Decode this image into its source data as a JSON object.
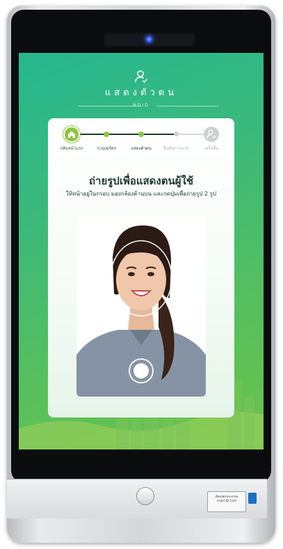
{
  "screen": {
    "title": "แสดงตัวตน",
    "subtitle": "NDID",
    "colors": {
      "accent": "#8cc63f",
      "text_dark": "#1e3a2c",
      "muted": "#b5c4bb"
    }
  },
  "stepper": {
    "steps": [
      {
        "label": "กลับหน้าแรก",
        "icon": "home-icon",
        "state": "done"
      },
      {
        "label": "ระบุบอร์ตร",
        "state": "done"
      },
      {
        "label": "แสดงตัวตน",
        "state": "current"
      },
      {
        "label": "ยืนยันการอาย",
        "state": "pending"
      },
      {
        "label": "เสร็จสิ้น",
        "icon": "user-check-icon",
        "state": "pending"
      }
    ]
  },
  "instructions": {
    "title": "ถ่ายรูปเพื่อแสดงตนผู้ใช้",
    "subtitle": "ให้หน้าอยู่ในกรอบ มองกล้องด้านบน และกดปุ่มเพื่อถ่ายรูป 2 รูป"
  },
  "capture": {
    "icon": "shutter-icon"
  },
  "hardware": {
    "card_slot_label": "เสียบบัตรประชาชน",
    "card_slot_sublabel": "insert ID Card"
  }
}
